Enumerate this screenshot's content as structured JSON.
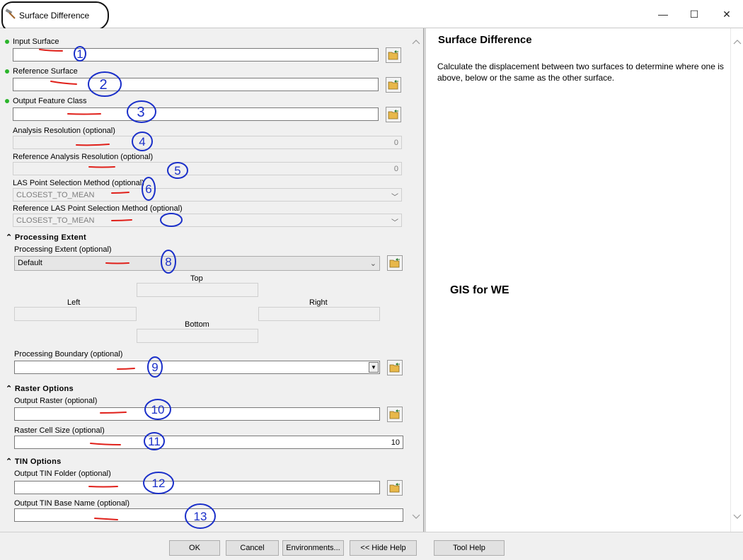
{
  "window": {
    "title": "Surface Difference",
    "minimize_glyph": "—",
    "maximize_glyph": "☐",
    "close_glyph": "✕"
  },
  "params": {
    "input_surface": {
      "label": "Input Surface",
      "value": ""
    },
    "reference_surface": {
      "label": "Reference Surface",
      "value": ""
    },
    "output_feature_class": {
      "label": "Output Feature Class",
      "value": ""
    },
    "analysis_resolution": {
      "label": "Analysis Resolution (optional)",
      "value": "0"
    },
    "reference_analysis_resolution": {
      "label": "Reference Analysis Resolution (optional)",
      "value": "0"
    },
    "las_point_selection": {
      "label": "LAS Point Selection Method (optional)",
      "value": "CLOSEST_TO_MEAN"
    },
    "reference_las_point_selection": {
      "label": "Reference LAS Point Selection Method (optional)",
      "value": "CLOSEST_TO_MEAN"
    }
  },
  "processing_extent": {
    "section_title": "Processing Extent",
    "label": "Processing Extent (optional)",
    "value": "Default",
    "top_label": "Top",
    "left_label": "Left",
    "right_label": "Right",
    "bottom_label": "Bottom",
    "boundary_label": "Processing Boundary (optional)",
    "boundary_value": ""
  },
  "raster_options": {
    "section_title": "Raster Options",
    "output_raster_label": "Output Raster (optional)",
    "output_raster_value": "",
    "cell_size_label": "Raster Cell Size (optional)",
    "cell_size_value": "10"
  },
  "tin_options": {
    "section_title": "TIN Options",
    "folder_label": "Output TIN Folder (optional)",
    "folder_value": "",
    "base_name_label": "Output TIN Base Name (optional)",
    "base_name_value": ""
  },
  "help": {
    "title": "Surface Difference",
    "text": "Calculate the displacement between two surfaces to determine where one is above, below or the same as the other surface.",
    "note": "GIS for WE"
  },
  "buttons": {
    "ok": "OK",
    "cancel": "Cancel",
    "environments": "Environments...",
    "hide_help": "<< Hide Help",
    "tool_help": "Tool Help"
  },
  "annotations": [
    "1",
    "2",
    "3",
    "4",
    "5",
    "6",
    "",
    "8",
    "9",
    "10",
    "11",
    "12",
    "13"
  ],
  "colors": {
    "annotation_marker": "#1a2fc9",
    "annotation_underline": "#e0201a",
    "required_dot": "#2bb52b",
    "folder_icon": "#e8b84a"
  }
}
